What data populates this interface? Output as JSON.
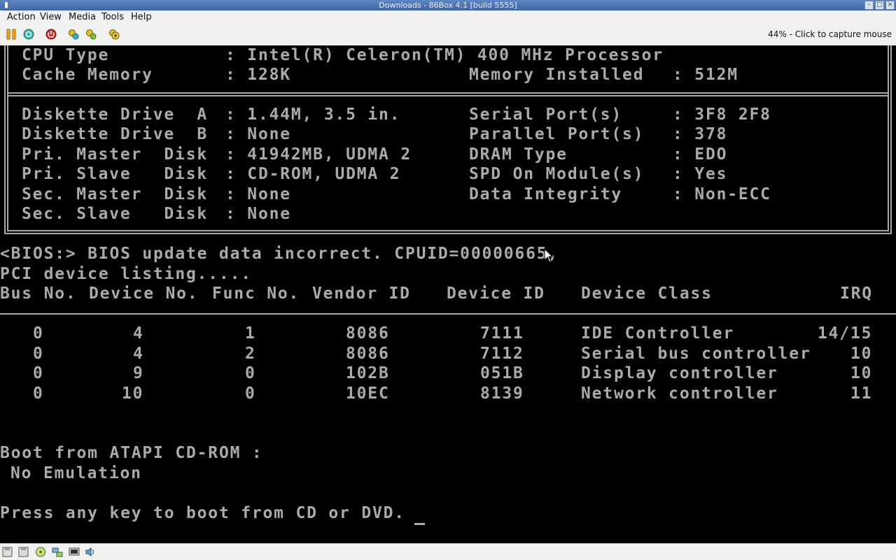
{
  "window": {
    "title": "Downloads - 86Box 4.1 [build 5555]"
  },
  "menu": [
    "Action",
    "View",
    "Media",
    "Tools",
    "Help"
  ],
  "toolbar": {
    "buttons": [
      "pause-icon",
      "reset-icon",
      "power-icon",
      "settings-icon",
      "settings-alt-icon",
      "screenshot-icon"
    ],
    "capture_text": "44% - Click to capture mouse"
  },
  "bios": {
    "cpu_type_label": "CPU Type",
    "cpu_type_value": ": Intel(R) Celeron(TM) 400 MHz Processor",
    "cache_label": "Cache Memory",
    "cache_value": ": 128K",
    "memory_label": "Memory Installed",
    "memory_value": ": 512M",
    "left_rows": [
      {
        "label": "Diskette Drive  A",
        "value": ": 1.44M, 3.5 in."
      },
      {
        "label": "Diskette Drive  B",
        "value": ": None"
      },
      {
        "label": "Pri. Master  Disk",
        "value": ": 41942MB, UDMA 2"
      },
      {
        "label": "Pri. Slave   Disk",
        "value": ": CD-ROM, UDMA 2"
      },
      {
        "label": "Sec. Master  Disk",
        "value": ": None"
      },
      {
        "label": "Sec. Slave   Disk",
        "value": ": None"
      }
    ],
    "right_rows": [
      {
        "label": "Serial Port(s)",
        "value": ": 3F8 2F8"
      },
      {
        "label": "Parallel Port(s)",
        "value": ": 378"
      },
      {
        "label": "DRAM Type",
        "value": ": EDO"
      },
      {
        "label": "SPD On Module(s)",
        "value": ": Yes"
      },
      {
        "label": "Data Integrity",
        "value": ": Non-ECC"
      }
    ],
    "bios_message": "<BIOS:> BIOS update data incorrect. CPUID=00000665,",
    "pci_heading": "PCI device listing.....",
    "pci_headers": [
      "Bus No.",
      "Device No.",
      "Func No.",
      "Vendor ID",
      "Device ID",
      "Device Class",
      "IRQ"
    ],
    "pci_rows": [
      {
        "bus": "0",
        "device": "4",
        "func": "1",
        "vendor": "8086",
        "device_id": "7111",
        "class": "IDE Controller",
        "irq": "14/15"
      },
      {
        "bus": "0",
        "device": "4",
        "func": "2",
        "vendor": "8086",
        "device_id": "7112",
        "class": "Serial bus controller",
        "irq": "10"
      },
      {
        "bus": "0",
        "device": "9",
        "func": "0",
        "vendor": "102B",
        "device_id": "051B",
        "class": "Display controller",
        "irq": "10"
      },
      {
        "bus": "0",
        "device": "10",
        "func": "0",
        "vendor": "10EC",
        "device_id": "8139",
        "class": "Network controller",
        "irq": "11"
      }
    ],
    "boot_line": "Boot from ATAPI CD-ROM :",
    "emulation_line": "No Emulation",
    "press_line": "Press any key to boot from CD or DVD."
  },
  "statusbar": {
    "icons": [
      "floppy-a-icon",
      "floppy-b-icon",
      "cdrom-icon",
      "network-icon",
      "display-icon",
      "sound-icon"
    ]
  }
}
